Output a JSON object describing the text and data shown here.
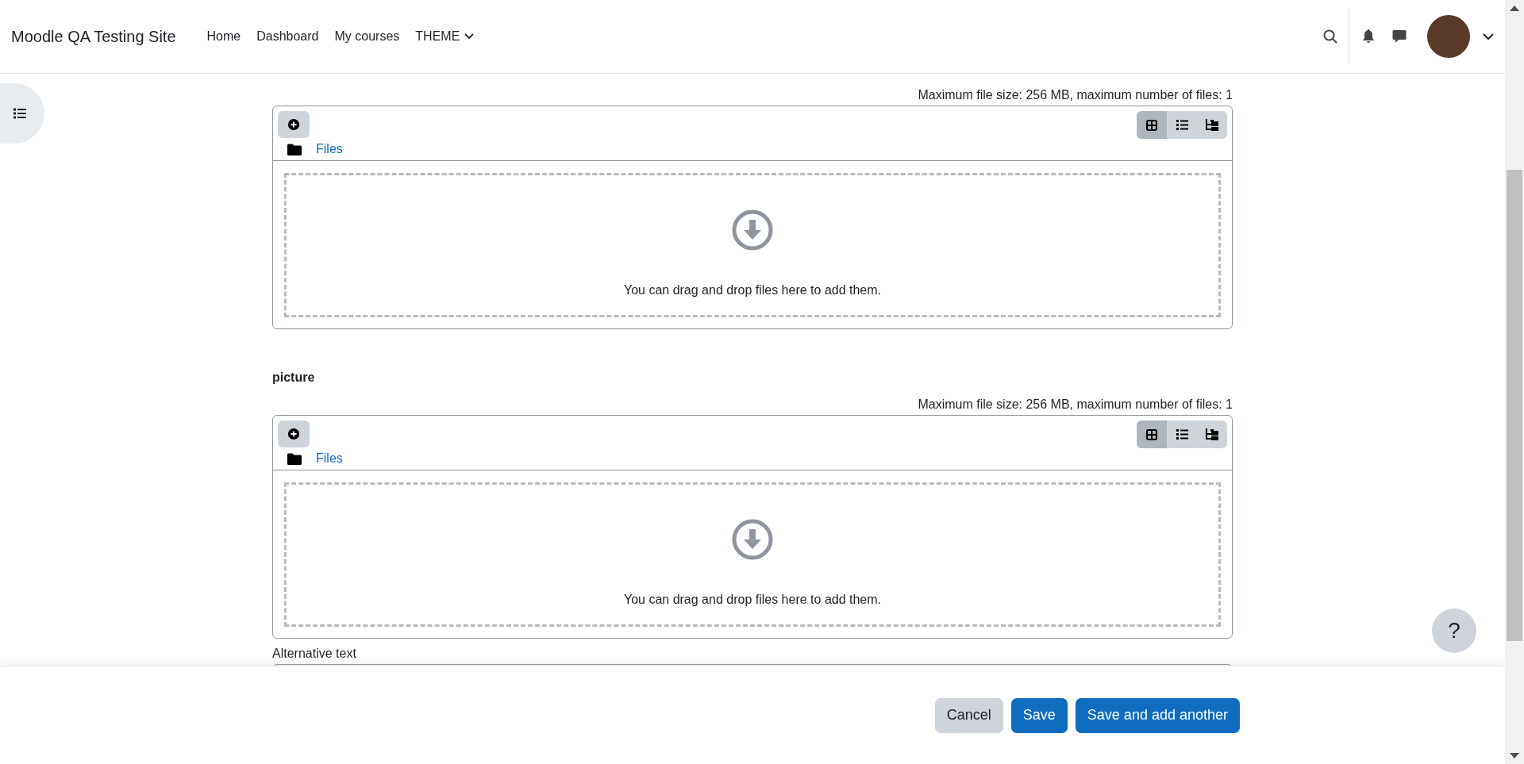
{
  "header": {
    "site_name": "Moodle QA Testing Site",
    "nav": [
      {
        "label": "Home",
        "dropdown": false
      },
      {
        "label": "Dashboard",
        "dropdown": false
      },
      {
        "label": "My courses",
        "dropdown": false
      },
      {
        "label": "THEME",
        "dropdown": true
      }
    ]
  },
  "filepickers": [
    {
      "limits": "Maximum file size: 256 MB, maximum number of files: 1",
      "folder": "Files",
      "dropzone": "You can drag and drop files here to add them.",
      "views": [
        {
          "kind": "icons",
          "selected": true
        },
        {
          "kind": "list",
          "selected": false
        },
        {
          "kind": "tree",
          "selected": false
        }
      ]
    },
    {
      "label": "picture",
      "limits": "Maximum file size: 256 MB, maximum number of files: 1",
      "folder": "Files",
      "dropzone": "You can drag and drop files here to add them.",
      "views": [
        {
          "kind": "icons",
          "selected": true
        },
        {
          "kind": "list",
          "selected": false
        },
        {
          "kind": "tree",
          "selected": false
        }
      ]
    }
  ],
  "alt_text": {
    "label": "Alternative text"
  },
  "help": {
    "label": "?"
  },
  "footer": {
    "buttons": [
      {
        "label": "Cancel",
        "kind": "secondary"
      },
      {
        "label": "Save",
        "kind": "primary"
      },
      {
        "label": "Save and add another",
        "kind": "primary"
      }
    ]
  }
}
